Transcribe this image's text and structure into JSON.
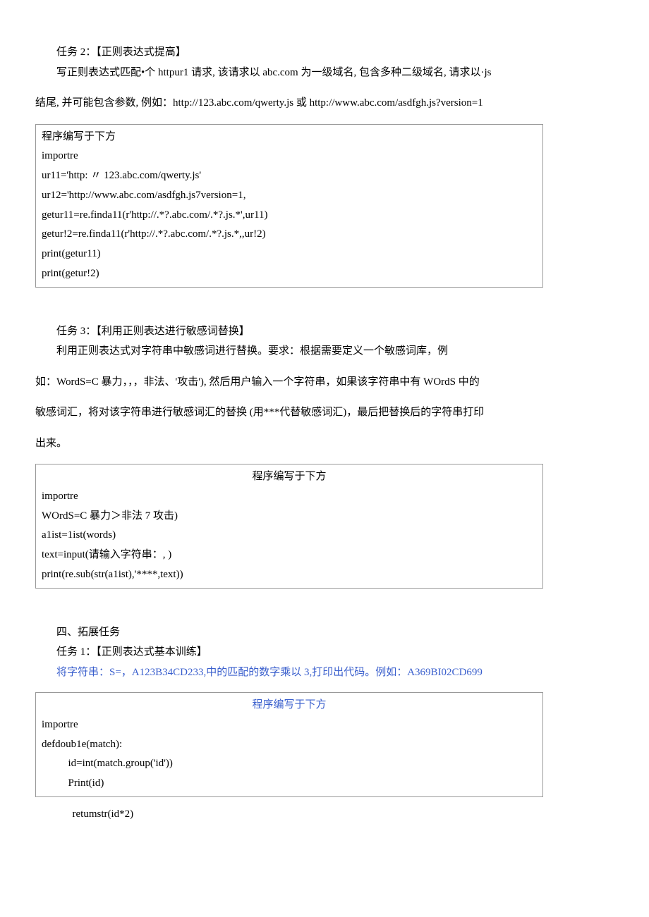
{
  "task2": {
    "title": "任务 2：【正则表达式提高】",
    "desc1": "写正则表达式匹配•个 httpur1 请求, 该请求以 abc.com 为一级域名, 包含多种二级域名, 请求以·js",
    "desc2": "结尾, 并可能包含参数, 例如：http://123.abc.com/qwerty.js 或 http://www.abc.com/asdfgh.js?version=1",
    "box": {
      "l1": "程序编写于下方",
      "l2": "importre",
      "l3": "ur11='http: 〃 123.abc.com/qwerty.js'",
      "l4": "ur12='http://www.abc.com/asdfgh.js7version=1,",
      "l5": "getur11=re.finda11(r'http://.*?.abc.com/.*?.js.*',ur11)",
      "l6": "getur!2=re.finda11(r'http://.*?.abc.com/.*?.js.*,,ur!2)",
      "l7": "print(getur11)",
      "l8": "print(getur!2)"
    }
  },
  "task3": {
    "title": "任务 3：【利用正则表达进行敏感词替换】",
    "desc1": "利用正则表达式对字符串中敏感词进行替换。要求：根据需要定义一个敏感词库，例",
    "desc2": "如：WordS=C 暴力，，，非法、'攻击'), 然后用户输入一个字符串，如果该字符串中有 WOrdS 中的",
    "desc3": "敏感词汇，将对该字符串进行敏感词汇的替换 (用***代替敏感词汇)，最后把替换后的字符串打印",
    "desc4": "出来。",
    "box": {
      "l1": "程序编写于下方",
      "l2": "importre",
      "l3": "WOrdS=C 暴力＞非法 7 攻击)",
      "l4": "a1ist=1ist(words)",
      "l5": "text=input(请输入字符串：, )",
      "l6": "print(re.sub(str(a1ist),'****,text))"
    }
  },
  "ext": {
    "heading": "四、拓展任务",
    "t1title": "任务 1：【正则表达式基本训练】",
    "t1desc": "将字符串：S=，A123B34CD233,中的匹配的数字乘以 3,打印出代码。例如：A369BI02CD699",
    "box": {
      "l1": "程序编写于下方",
      "l2": "importre",
      "l3": "defdoub1e(match):",
      "l4": "id=int(match.group('id'))",
      "l5": "Print(id)"
    },
    "after": "retumstr(id*2)"
  }
}
